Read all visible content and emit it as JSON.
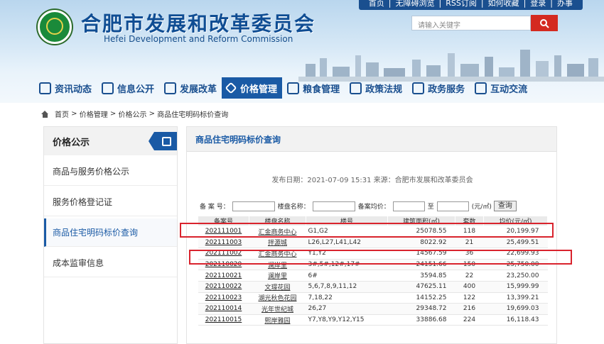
{
  "header": {
    "top_links": [
      "首页",
      "无障碍浏览",
      "RSS订阅",
      "如何收藏",
      "登录",
      "办事"
    ],
    "title_cn": "合肥市发展和改革委员会",
    "title_en": "Hefei Development and Reform Commission",
    "search_placeholder": "请输入关键字"
  },
  "nav": [
    {
      "label": "资讯动态"
    },
    {
      "label": "信息公开"
    },
    {
      "label": "发展改革"
    },
    {
      "label": "价格管理",
      "active": true
    },
    {
      "label": "粮食管理"
    },
    {
      "label": "政策法规"
    },
    {
      "label": "政务服务"
    },
    {
      "label": "互动交流"
    }
  ],
  "breadcrumb": [
    "首页",
    "价格管理",
    "价格公示",
    "商品住宅明码标价查询"
  ],
  "sidebar": {
    "title": "价格公示",
    "items": [
      {
        "label": "商品与服务价格公示"
      },
      {
        "label": "服务价格登记证"
      },
      {
        "label": "商品住宅明码标价查询",
        "active": true
      },
      {
        "label": "成本监审信息"
      }
    ]
  },
  "main": {
    "title": "商品住宅明码标价查询",
    "publish": "发布日期：2021-07-09 15:31   来源：合肥市发展和改革委员会",
    "filter": {
      "record_label": "备 案 号：",
      "building_label": "楼盘名称：",
      "avg_label": "备案均价：",
      "to_label": "至",
      "unit_label": "(元/㎡)",
      "query_label": "查询"
    },
    "columns": [
      "备案号",
      "楼盘名称",
      "楼号",
      "建筑面积(㎡)",
      "套数",
      "均价(元/㎡)"
    ],
    "rows": [
      [
        "202111001",
        "汇金商务中心",
        "G1,G2",
        "25078.55",
        "118",
        "20,199.97"
      ],
      [
        "202111003",
        "拌源城",
        "L26,L27,L41,L42",
        "8022.92",
        "21",
        "25,499.51"
      ],
      [
        "202111002",
        "汇金商务中心",
        "Y1,Y2",
        "14567.59",
        "36",
        "22,699.93"
      ],
      [
        "202110020",
        "澜岸里",
        "3#,5#,12#,17#",
        "24151.66",
        "150",
        "25,750.00"
      ],
      [
        "202110021",
        "澜岸里",
        "6#",
        "3594.85",
        "22",
        "23,250.00"
      ],
      [
        "202110022",
        "文璟花园",
        "5,6,7,8,9,11,12",
        "47625.11",
        "400",
        "15,999.99"
      ],
      [
        "202110023",
        "湖光秋色花园",
        "7,18,22",
        "14152.25",
        "122",
        "13,399.21"
      ],
      [
        "202110014",
        "光年世纪城",
        "26,27",
        "29348.72",
        "216",
        "19,699.03"
      ],
      [
        "202110015",
        "熙岸雅园",
        "Y7,Y8,Y9,Y12,Y15",
        "33886.68",
        "224",
        "16,118.43"
      ]
    ]
  },
  "colors": {
    "accent": "#1a5aa5",
    "highlight": "#d9232d",
    "search_button": "#d42a20"
  }
}
